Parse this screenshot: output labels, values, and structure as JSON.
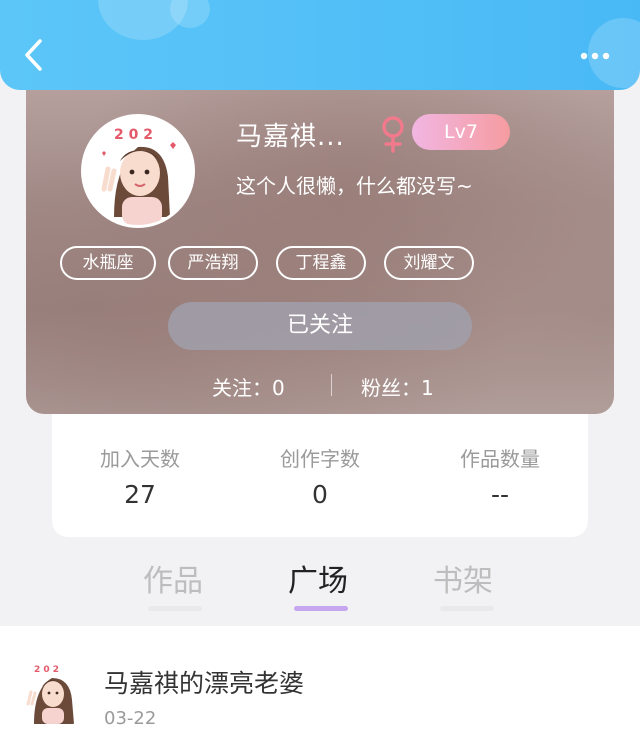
{
  "header": {
    "back_icon": "chevron-left-icon",
    "more_icon": "more-dots-icon",
    "background": "#4fbdf7"
  },
  "profile": {
    "name": "马嘉祺...",
    "gender_icon": "female-icon",
    "gender_color": "#f07a8c",
    "level": "Lv7",
    "bio": "这个人很懒，什么都没写~",
    "tags": [
      "水瓶座",
      "严浩翔",
      "丁程鑫",
      "刘耀文"
    ],
    "follow_button": "已关注",
    "following": "关注：0",
    "fans": "粉丝：1"
  },
  "stats": [
    {
      "label": "加入天数",
      "value": "27"
    },
    {
      "label": "创作字数",
      "value": "0"
    },
    {
      "label": "作品数量",
      "value": "--"
    }
  ],
  "tabs": [
    {
      "label": "作品",
      "active": false
    },
    {
      "label": "广场",
      "active": true
    },
    {
      "label": "书架",
      "active": false
    }
  ],
  "accent_color": "#c7a6f0",
  "posts": [
    {
      "title": "马嘉祺的漂亮老婆",
      "date": "03-22"
    }
  ]
}
